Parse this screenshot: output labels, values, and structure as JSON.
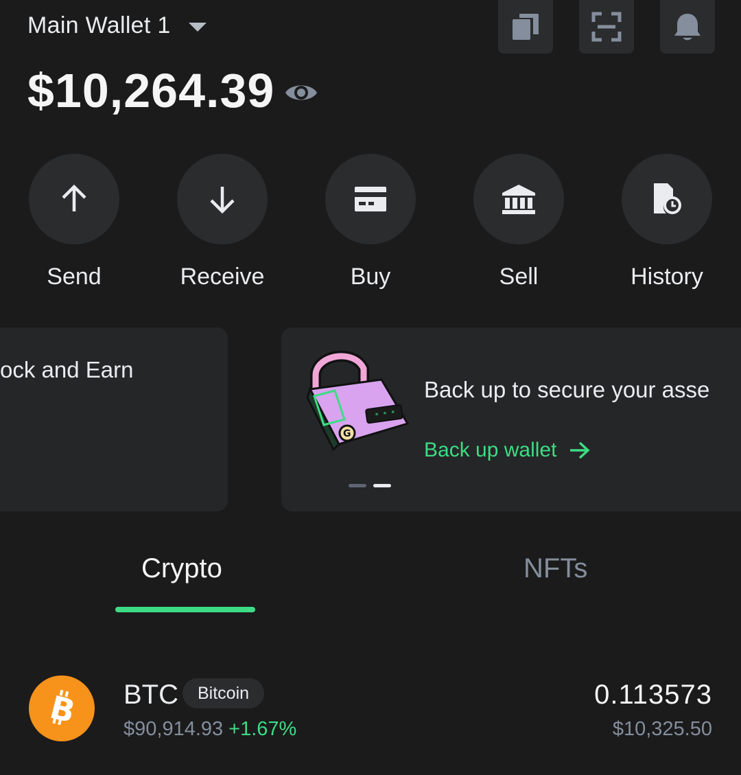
{
  "header": {
    "wallet_name": "Main Wallet 1",
    "balance": "$10,264.39"
  },
  "actions": [
    {
      "label": "Send",
      "icon": "arrow-up-icon"
    },
    {
      "label": "Receive",
      "icon": "arrow-down-icon"
    },
    {
      "label": "Buy",
      "icon": "card-icon"
    },
    {
      "label": "Sell",
      "icon": "bank-icon"
    },
    {
      "label": "History",
      "icon": "history-icon"
    }
  ],
  "banners": {
    "left_title": "ock and Earn",
    "right_title": "Back up to secure your asse",
    "right_link": "Back up wallet"
  },
  "tabs": {
    "crypto": "Crypto",
    "nfts": "NFTs",
    "active": "crypto"
  },
  "assets": [
    {
      "symbol": "BTC",
      "name": "Bitcoin",
      "price": "$90,914.93",
      "change": "+1.67%",
      "amount": "0.113573",
      "value": "$10,325.50"
    }
  ],
  "colors": {
    "background": "#1b1b1c",
    "surface": "#2b2c2e",
    "accent_green": "#3ddc84",
    "muted_text": "#848e9c",
    "btc_orange": "#f7931a"
  }
}
